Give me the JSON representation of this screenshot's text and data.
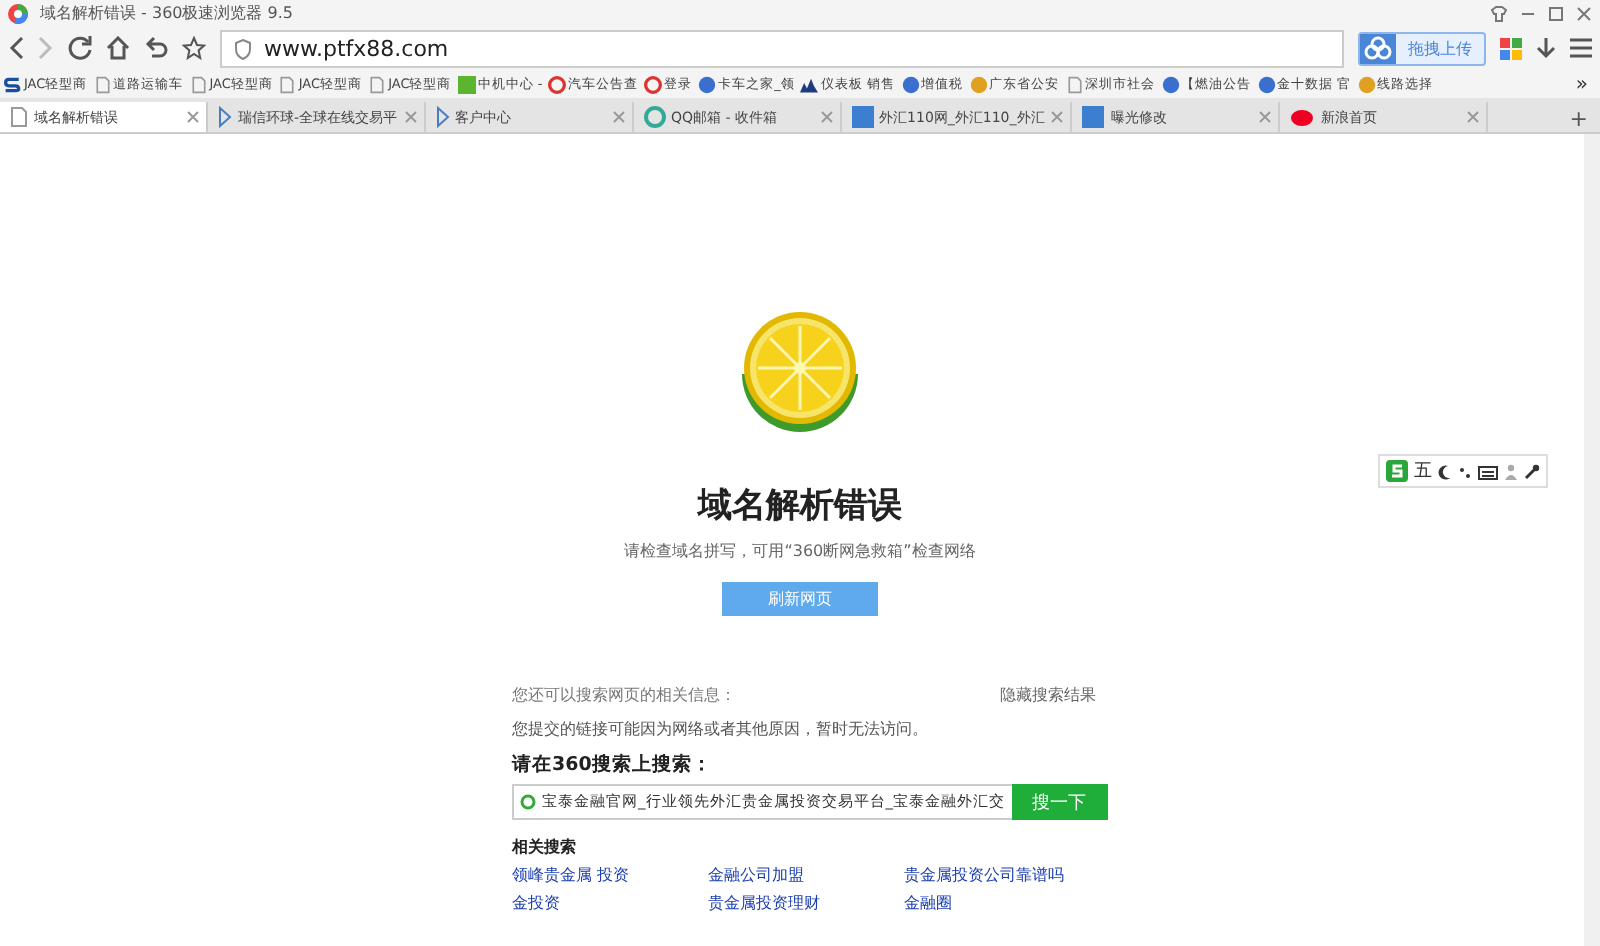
{
  "window": {
    "title": "域名解析错误 - 360极速浏览器 9.5"
  },
  "address_bar": {
    "url": "www.ptfx88.com"
  },
  "upload_button": "拖拽上传",
  "bookmarks": [
    {
      "label": "JAC轻型商",
      "kind": "jac"
    },
    {
      "label": "道路运输车",
      "kind": "page"
    },
    {
      "label": "JAC轻型商",
      "kind": "page"
    },
    {
      "label": "JAC轻型商",
      "kind": "page"
    },
    {
      "label": "JAC轻型商",
      "kind": "page"
    },
    {
      "label": "中机中心 -",
      "kind": "green"
    },
    {
      "label": "汽车公告查",
      "kind": "red"
    },
    {
      "label": "登录",
      "kind": "red"
    },
    {
      "label": "卡车之家_领",
      "kind": "blue"
    },
    {
      "label": "仪表板 销售",
      "kind": "chart"
    },
    {
      "label": "增值税",
      "kind": "blue"
    },
    {
      "label": "广东省公安",
      "kind": "orange"
    },
    {
      "label": "深圳市社会",
      "kind": "page"
    },
    {
      "label": "【燃油公告",
      "kind": "blue"
    },
    {
      "label": "金十数据 官",
      "kind": "blue"
    },
    {
      "label": "线路选择",
      "kind": "orange"
    }
  ],
  "bookmarks_more": "»",
  "tabs": [
    {
      "label": "域名解析错误",
      "selected": true,
      "kind": "page"
    },
    {
      "label": "瑞信环球-全球在线交易平",
      "selected": false,
      "kind": "arrow"
    },
    {
      "label": "客户中心",
      "selected": false,
      "kind": "arrow"
    },
    {
      "label": "QQ邮箱 - 收件箱",
      "selected": false,
      "kind": "mail"
    },
    {
      "label": "外汇110网_外汇110_外汇",
      "selected": false,
      "kind": "fx"
    },
    {
      "label": "曝光修改",
      "selected": false,
      "kind": "fx"
    },
    {
      "label": "新浪首页",
      "selected": false,
      "kind": "sina"
    }
  ],
  "new_tab": "+",
  "error": {
    "title": "域名解析错误",
    "hint": "请检查域名拼写，可用“360断网急救箱”检查网络",
    "refresh_button": "刷新网页"
  },
  "search_section": {
    "intro": "您还可以搜索网页的相关信息：",
    "hide_link": "隐藏搜索结果",
    "notice": "您提交的链接可能因为网络或者其他原因，暂时无法访问。",
    "prompt": "请在360搜索上搜索：",
    "query": "宝泰金融官网_行业领先外汇贵金属投资交易平台_宝泰金融外汇交",
    "search_button": "搜一下",
    "related_title": "相关搜索",
    "related": [
      "领峰贵金属 投资",
      "金融公司加盟",
      "贵金属投资公司靠谱吗",
      "金投资",
      "贵金属投资理财",
      "金融圈"
    ]
  },
  "ime_toolbar": {
    "mode": "五"
  }
}
